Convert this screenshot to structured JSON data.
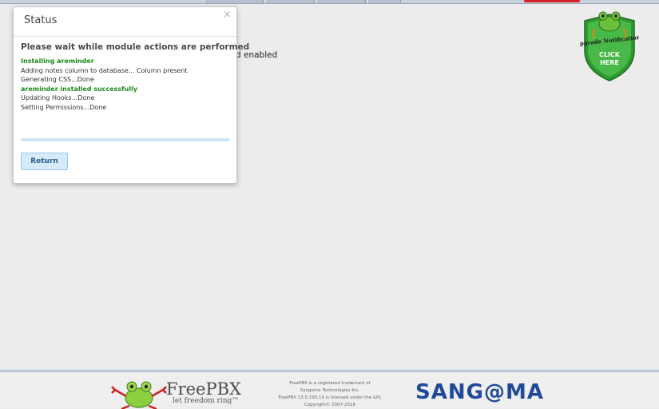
{
  "background": {
    "partial_text": "d enabled"
  },
  "badge": {
    "line1": "Upgrade Notifications",
    "line2": "CLICK",
    "line3": "HERE"
  },
  "dialog": {
    "title": "Status",
    "close": "×",
    "heading": "Please wait while module actions are performed",
    "log": [
      {
        "text": "Installing areminder",
        "type": "ok"
      },
      {
        "text": "Adding notes column to database... Column present",
        "type": "normal"
      },
      {
        "text": "Generating CSS...Done",
        "type": "normal"
      },
      {
        "text": "areminder installed successfully",
        "type": "ok"
      },
      {
        "text": "Updating Hooks...Done",
        "type": "normal"
      },
      {
        "text": "Setting Permissions...Done",
        "type": "normal"
      }
    ],
    "progress": 1.0,
    "return_label": "Return"
  },
  "footer": {
    "freepbx_name": "FreePBX",
    "freepbx_slogan": "let freedom ring™",
    "legal": [
      "FreePBX is a registered trademark of",
      "Sangoma Technologies Inc.",
      "FreePBX 13.0.195.19 is licensed under the GPL",
      "Copyright© 2007-2018"
    ],
    "sangoma": "SANG@MA"
  },
  "colors": {
    "accent_green": "#1c8a1c",
    "sangoma_blue": "#1f4a9c",
    "alert_red": "#d8212b"
  }
}
